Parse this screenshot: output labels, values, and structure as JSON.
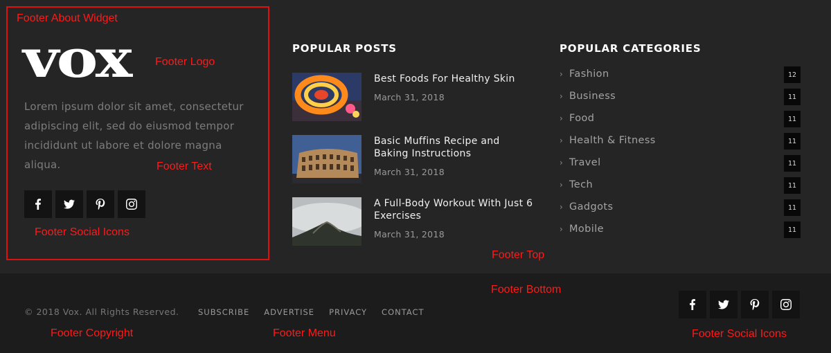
{
  "annotations": {
    "about_widget": "Footer About Widget",
    "logo": "Footer Logo",
    "text": "Footer Text",
    "social_icons": "Footer Social Icons",
    "footer_top": "Footer Top",
    "footer_bottom": "Footer Bottom",
    "copyright": "Footer Copyright",
    "menu": "Footer Menu",
    "social_icons_bottom": "Footer Social Icons"
  },
  "about": {
    "logo_text": "vox",
    "text": "Lorem ipsum dolor sit amet, consectetur adipiscing elit, sed do eiusmod tempor incididunt ut labore et dolore magna aliqua."
  },
  "social": [
    "facebook-icon",
    "twitter-icon",
    "pinterest-icon",
    "instagram-icon"
  ],
  "popular_posts": {
    "title": "POPULAR POSTS",
    "items": [
      {
        "title": "Best Foods For Healthy Skin",
        "date": "March 31, 2018"
      },
      {
        "title": "Basic Muffins Recipe and Baking Instructions",
        "date": "March 31, 2018"
      },
      {
        "title": "A Full-Body Workout With Just 6 Exercises",
        "date": "March 31, 2018"
      }
    ]
  },
  "popular_categories": {
    "title": "POPULAR CATEGORIES",
    "items": [
      {
        "name": "Fashion",
        "count": "12"
      },
      {
        "name": "Business",
        "count": "11"
      },
      {
        "name": "Food",
        "count": "11"
      },
      {
        "name": "Health & Fitness",
        "count": "11"
      },
      {
        "name": "Travel",
        "count": "11"
      },
      {
        "name": "Tech",
        "count": "11"
      },
      {
        "name": "Gadgots",
        "count": "11"
      },
      {
        "name": "Mobile",
        "count": "11"
      }
    ]
  },
  "bottom": {
    "copyright": "© 2018 Vox. All Rights Reserved.",
    "menu": [
      "SUBSCRIBE",
      "ADVERTISE",
      "PRIVACY",
      "CONTACT"
    ]
  },
  "colors": {
    "top_background": "#252525",
    "bottom_background": "#1c1c1c",
    "annotation": "#ff1a1a",
    "count_badge": "#080808"
  }
}
